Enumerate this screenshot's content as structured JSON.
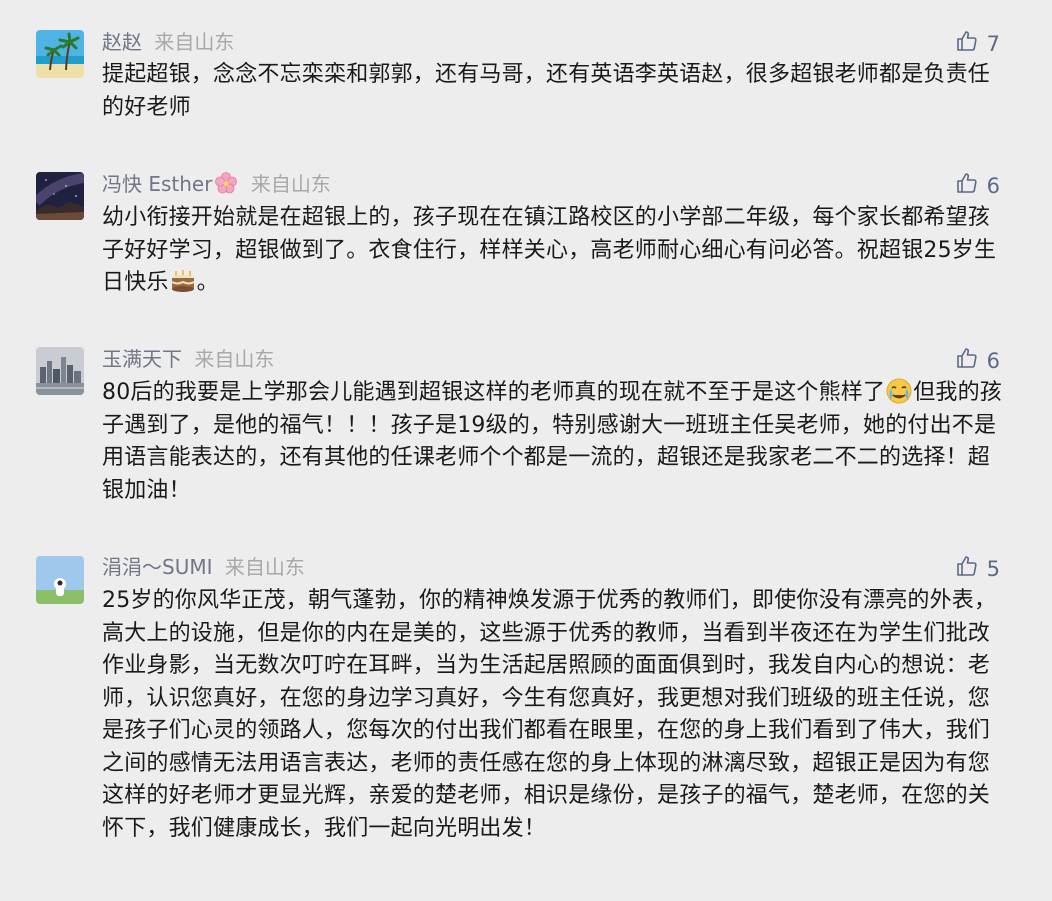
{
  "comments": [
    {
      "avatar_icon": "beach-palm-avatar",
      "name": "赵赵",
      "source": "来自山东",
      "likes": "7",
      "text": "提起超银，念念不忘栾栾和郭郭，还有马哥，还有英语李英语赵，很多超银老师都是负责任的好老师"
    },
    {
      "avatar_icon": "night-sky-avatar",
      "name": "冯快 Esther",
      "name_emoji": "cherry-blossom-icon",
      "source": "来自山东",
      "likes": "6",
      "text_before_emoji": "幼小衔接开始就是在超银上的，孩子现在在镇江路校区的小学部二年级，每个家长都希望孩子好好学习，超银做到了。衣食住行，样样关心，高老师耐心细心有问必答。祝超银25岁生日快乐",
      "inline_emoji": "birthday-cake-icon",
      "text_after_emoji": "。"
    },
    {
      "avatar_icon": "city-skyline-avatar",
      "name": "玉满天下",
      "source": "来自山东",
      "likes": "6",
      "text_line1": "80后的我要是上学那会儿能遇到超银这样的老师真的现在就不至于是这个熊样了",
      "inline_emoji": "crying-face-icon",
      "text_after_emoji": "但我的孩子遇到了，是他的福气！！！孩子是19级的，特别感谢大一班班主任吴老师，她的付出不是用语言能表达的，还有其他的任课老师个个都是一流的，超银还是我家老二不二的选择！超银加油！"
    },
    {
      "avatar_icon": "sky-figure-avatar",
      "name": "涓涓～SUMI",
      "source": "来自山东",
      "likes": "5",
      "text": "25岁的你风华正茂，朝气蓬勃，你的精神焕发源于优秀的教师们，即使你没有漂亮的外表，高大上的设施，但是你的内在是美的，这些源于优秀的教师，当看到半夜还在为学生们批改作业身影，当无数次叮咛在耳畔，当为生活起居照顾的面面俱到时，我发自内心的想说：老师，认识您真好，在您的身边学习真好，今生有您真好，我更想对我们班级的班主任说，您是孩子们心灵的领路人，您每次的付出我们都看在眼里，在您的身上我们看到了伟大，我们之间的感情无法用语言表达，老师的责任感在您的身上体现的淋漓尽致，超银正是因为有您这样的好老师才更显光辉，亲爱的楚老师，相识是缘份，是孩子的福气，楚老师，在您的关怀下，我们健康成长，我们一起向光明出发！"
    }
  ],
  "colors": {
    "background": "#ededed",
    "name": "#6f7686",
    "source": "#a8a8a8",
    "like": "#5b6a8a",
    "text": "#1a1a1a"
  }
}
